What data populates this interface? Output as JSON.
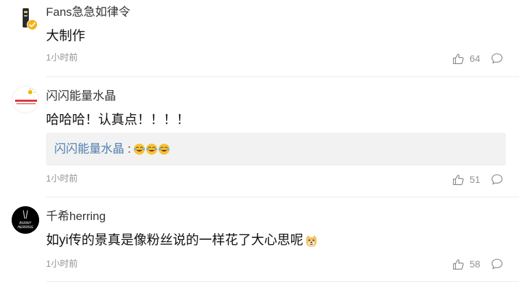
{
  "comments": [
    {
      "username": "Fans急急如律令",
      "content": "大制作",
      "time": "1小时前",
      "likes": "64",
      "avatar_icon": "dark-phone-avatar-icon",
      "badge_icon": "verified-badge-icon"
    },
    {
      "username": "闪闪能量水晶",
      "content": "哈哈哈！认真点！！！！",
      "time": "1小时前",
      "likes": "51",
      "avatar_icon": "sun-logo-avatar-icon",
      "reply": {
        "user": "闪闪能量水晶",
        "colon": ":",
        "emojis": [
          "laughing-crying-emoji",
          "laughing-crying-emoji",
          "laughing-crying-emoji"
        ]
      }
    },
    {
      "username": "千希herring",
      "content": "如yi传的景真是像粉丝说的一样花了大心思呢",
      "time": "1小时前",
      "likes": "58",
      "avatar_icon": "bunny-herring-avatar-icon",
      "avatar_text_1": "BUNNY",
      "avatar_text_2": "HERRING",
      "trailing_emoji": "doge-emoji"
    }
  ],
  "colors": {
    "link": "#507daf",
    "muted": "#939393",
    "reply_bg": "#f2f2f2",
    "badge": "#f6b21c"
  }
}
